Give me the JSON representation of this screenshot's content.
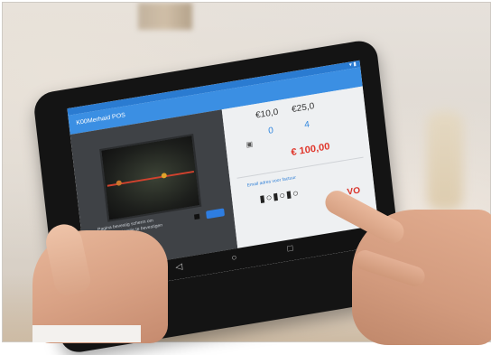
{
  "screen": {
    "app_title": "K00Merhaid POS",
    "left_panel": {
      "caption": "Pagina bevestig scherm om boekingsinstructie te bevestigen"
    },
    "right_panel": {
      "amounts": [
        "€10,0",
        "€25,0"
      ],
      "quantities": [
        "0",
        "4"
      ],
      "total": "€ 100,00",
      "email_link": "Email adres voor factuur",
      "pay_icons": "▮○▮○▮○",
      "cut_label": "VO"
    },
    "nav": [
      "◁",
      "○",
      "□"
    ]
  },
  "colors": {
    "accent": "#3b8fe3",
    "total_red": "#e0352a",
    "scan_red": "#d2422e"
  }
}
